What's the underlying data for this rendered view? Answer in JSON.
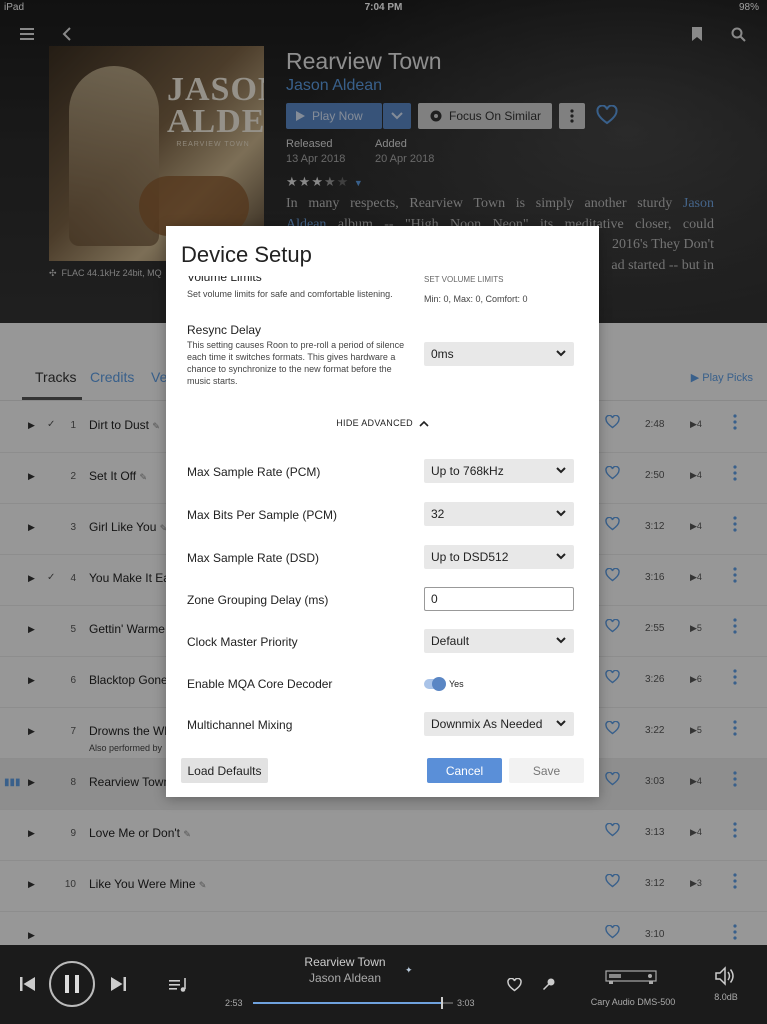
{
  "status": {
    "device": "iPad",
    "time": "7:04 PM",
    "battery": "98%"
  },
  "album": {
    "title": "Rearview Town",
    "artist": "Jason Aldean",
    "cover_title_line1": "JASON",
    "cover_title_line2": "ALDEAN",
    "cover_subtitle": "REARVIEW TOWN",
    "format": "FLAC 44.1kHz 24bit, MQ",
    "play_now": "Play Now",
    "focus_similar": "Focus On Similar",
    "released_label": "Released",
    "released_value": "13 Apr 2018",
    "added_label": "Added",
    "added_value": "20 Apr 2018",
    "rating": 3.5,
    "review_lines": [
      {
        "pre": "In many respects, Rearview Town is simply another sturdy ",
        "link": "Jason",
        "post": ""
      },
      {
        "pre": "",
        "link": "Aldean",
        "post": " album -- \"High Noon Neon\" its meditative closer, could"
      },
      {
        "pre": "",
        "link": "",
        "post": "2016's They Don't"
      },
      {
        "pre": "",
        "link": "",
        "post": "ad started -- but in"
      }
    ]
  },
  "tabs": [
    {
      "label": "Tracks",
      "active": true
    },
    {
      "label": "Credits",
      "active": false
    },
    {
      "label": "Ve",
      "active": false
    }
  ],
  "play_picks": "Play Picks",
  "tracks": [
    {
      "num": "1",
      "title": "Dirt to Dust",
      "checked": true,
      "duration": "2:48",
      "plays": "4",
      "sub": ""
    },
    {
      "num": "2",
      "title": "Set It Off",
      "checked": false,
      "duration": "2:50",
      "plays": "4",
      "sub": ""
    },
    {
      "num": "3",
      "title": "Girl Like You",
      "checked": false,
      "duration": "3:12",
      "plays": "4",
      "sub": ""
    },
    {
      "num": "4",
      "title": "You Make It Ea",
      "checked": true,
      "duration": "3:16",
      "plays": "4",
      "sub": ""
    },
    {
      "num": "5",
      "title": "Gettin' Warme",
      "checked": false,
      "duration": "2:55",
      "plays": "5",
      "sub": ""
    },
    {
      "num": "6",
      "title": "Blacktop Gone",
      "checked": false,
      "duration": "3:26",
      "plays": "6",
      "sub": ""
    },
    {
      "num": "7",
      "title": "Drowns the Wh",
      "checked": false,
      "duration": "3:22",
      "plays": "5",
      "sub": "Also performed by"
    },
    {
      "num": "8",
      "title": "Rearview Town",
      "checked": false,
      "duration": "3:03",
      "plays": "4",
      "sub": "",
      "playing": true
    },
    {
      "num": "9",
      "title": "Love Me or Don't",
      "checked": false,
      "duration": "3:13",
      "plays": "4",
      "sub": ""
    },
    {
      "num": "10",
      "title": "Like You Were Mine",
      "checked": false,
      "duration": "3:12",
      "plays": "3",
      "sub": ""
    },
    {
      "num": "",
      "title": "",
      "checked": false,
      "duration": "3:10",
      "plays": "",
      "sub": ""
    }
  ],
  "dialog": {
    "title": "Device Setup",
    "volume_limits_label": "Volume Limits",
    "volume_limits_desc": "Set volume limits for safe and comfortable listening.",
    "volume_limits_value_hdr": "SET VOLUME LIMITS",
    "volume_limits_value": "Min: 0, Max: 0, Comfort: 0",
    "resync_label": "Resync Delay",
    "resync_desc": "This setting causes Roon to pre-roll a period of silence each time it switches formats. This gives hardware a chance to synchronize to the new format before the music starts.",
    "resync_value": "0ms",
    "hide_advanced": "HIDE ADVANCED",
    "max_sr_pcm_label": "Max Sample Rate (PCM)",
    "max_sr_pcm_value": "Up to 768kHz",
    "max_bits_label": "Max Bits Per Sample (PCM)",
    "max_bits_value": "32",
    "max_sr_dsd_label": "Max Sample Rate (DSD)",
    "max_sr_dsd_value": "Up to DSD512",
    "zone_delay_label": "Zone Grouping Delay (ms)",
    "zone_delay_value": "0",
    "clock_label": "Clock Master Priority",
    "clock_value": "Default",
    "mqa_label": "Enable MQA Core Decoder",
    "mqa_value": "Yes",
    "mqa_on": true,
    "mix_label": "Multichannel Mixing",
    "mix_value": "Downmix As Needed",
    "load_defaults": "Load Defaults",
    "cancel": "Cancel",
    "save": "Save"
  },
  "player": {
    "title": "Rearview Town",
    "artist": "Jason Aldean",
    "elapsed": "2:53",
    "total": "3:03",
    "progress": 0.945,
    "zone": "Cary Audio DMS-500",
    "volume": "8.0dB"
  },
  "colors": {
    "accent": "#5a86c4",
    "link": "#5c9be0",
    "header_bg": "#222222"
  },
  "icons": [
    "hamburger-icon",
    "back-icon",
    "bookmark-icon",
    "search-icon",
    "play-icon",
    "chevron-down-icon",
    "focus-icon",
    "more-vertical-icon",
    "heart-icon",
    "star-icon",
    "previous-icon",
    "pause-icon",
    "next-icon",
    "queue-icon",
    "pin-icon",
    "device-icon",
    "speaker-icon",
    "chevron-up-icon"
  ]
}
